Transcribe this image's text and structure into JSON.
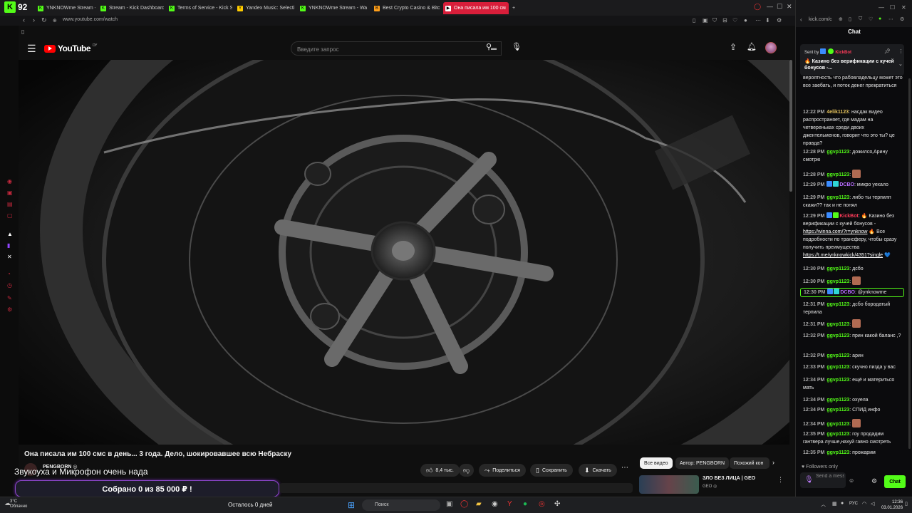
{
  "browser": {
    "stream_badge": "92",
    "tabs": [
      {
        "label": "YNKNOWme Stream - Wa",
        "fav": "K",
        "color": "#53fc18"
      },
      {
        "label": "Stream - Kick Dashboard",
        "fav": "K",
        "color": "#53fc18"
      },
      {
        "label": "Terms of Service - Kick St",
        "fav": "K",
        "color": "#53fc18"
      },
      {
        "label": "Yandex Music: Selecti",
        "fav": "Y",
        "color": "#ffcc00"
      },
      {
        "label": "YNKNOWme Stream - Wa",
        "fav": "K",
        "color": "#53fc18"
      },
      {
        "label": "Best Crypto Casino & Bitc",
        "fav": "B",
        "color": "#ff9f1a"
      },
      {
        "label": "Она писала им 100 см",
        "fav": "▶",
        "color": "#ffffff"
      }
    ],
    "new_tab": "+",
    "url": "www.youtube.com/watch"
  },
  "youtube": {
    "logo_text": "YouTube",
    "logo_region": "DY",
    "search_placeholder": "Введите запрос",
    "video_title": "Она писала им 100 смс в день... 3 года. Дело, шокировавшее всю Небраску",
    "channel_name": "PENGBORN ◎",
    "overlay_text": "Звукоуха и Микрофон очень нада",
    "actions": {
      "likes": "8,4 тыс.",
      "share": "Поделиться",
      "save": "Сохранить",
      "download": "Скачать"
    },
    "chips": [
      "Все видео",
      "Автор: PENGBORN",
      "Похожий кон"
    ],
    "related": {
      "title": "ЗЛО БЕЗ ЛИЦА | GEO",
      "channel": "GEO ◎"
    }
  },
  "donation": {
    "text": "Собрано 0  из 85 000 ₽ !"
  },
  "taskbar": {
    "weather_temp": "3°C",
    "weather_desc": "Облачно",
    "countdown": "Осталось 0 дней",
    "search": "Поиск",
    "lang": "РУС",
    "time": "12:36",
    "date": "03.01.2026"
  },
  "chat": {
    "url": "kick.com/c",
    "header": "Chat",
    "pinned": {
      "sent_by": "Sent by",
      "sender": "KickBot",
      "message": "🔥 Казино без верификации с кучей бонусов -..."
    },
    "messages": [
      {
        "time": "",
        "user": "",
        "text": "вероятность что рабовладельцу может это все заебать, и поток денег прекратиться"
      },
      {
        "time": "12:22 PM",
        "user": "4elik1123",
        "ucls": "gold",
        "text": "насдак видео распространяет, где мадам на четвереньках среди двоих джентельменов, говорит что это ты? це правда?"
      },
      {
        "time": "12:28 PM",
        "user": "ggvp1123",
        "text": "дожился,Арину смотрю"
      },
      {
        "time": "12:28 PM",
        "user": "ggvp1123",
        "text": "",
        "emote": true
      },
      {
        "time": "12:29 PM",
        "user": "DCBO",
        "ucls": "purple",
        "badges": true,
        "text": "микро уехало"
      },
      {
        "time": "12:29 PM",
        "user": "ggvp1123",
        "text": "либо ты терпилп скажи?? так и не понял"
      },
      {
        "time": "12:29 PM",
        "user": "KickBot",
        "ucls": "red",
        "badges": true,
        "text": "🔥 Казино без верификации с кучей бонусов -",
        "link1": "https://winna.com/?r=ynknow",
        "text2": "🔥 Все подробности по трансферу, чтобы сразу получить преимущества",
        "link2": "https://t.me/ynknowkick/4351?single",
        "tail": "💙"
      },
      {
        "time": "12:30 PM",
        "user": "ggvp1123",
        "text": "дсбо"
      },
      {
        "time": "12:30 PM",
        "user": "ggvp1123",
        "text": "",
        "emote": true
      },
      {
        "time": "12:30 PM",
        "user": "DCBO",
        "ucls": "purple",
        "badges": true,
        "text": "@ynknowme",
        "hl": true
      },
      {
        "time": "12:31 PM",
        "user": "ggvp1123",
        "text": "дсбо бородатый терпила"
      },
      {
        "time": "12:31 PM",
        "user": "ggvp1123",
        "text": "",
        "emote": true
      },
      {
        "time": "12:32 PM",
        "user": "ggvp1123",
        "text": "прин какой баланс ,?"
      },
      {
        "time": "12:32 PM",
        "user": "ggvp1123",
        "text": "арин"
      },
      {
        "time": "12:33 PM",
        "user": "ggvp1123",
        "text": "скучно пизда у вас"
      },
      {
        "time": "12:34 PM",
        "user": "ggvp1123",
        "text": "ещё и материться мать"
      },
      {
        "time": "12:34 PM",
        "user": "ggvp1123",
        "text": "охуела"
      },
      {
        "time": "12:34 PM",
        "user": "ggvp1123",
        "text": "СПИД инфо"
      },
      {
        "time": "12:34 PM",
        "user": "ggvp1123",
        "text": "",
        "emote": true
      },
      {
        "time": "12:35 PM",
        "user": "ggvp1123",
        "text": "гоу продадим гантвера лучше,нахуй гавно смотреть"
      },
      {
        "time": "12:35 PM",
        "user": "ggvp1123",
        "text": "прожарим"
      }
    ],
    "followers_only": "Followers only",
    "input_placeholder": "Send a message",
    "send_label": "Chat"
  },
  "colors": {
    "kick_green": "#53fc18",
    "yt_red": "#ff0000",
    "active_tab": "#d81e3a"
  }
}
